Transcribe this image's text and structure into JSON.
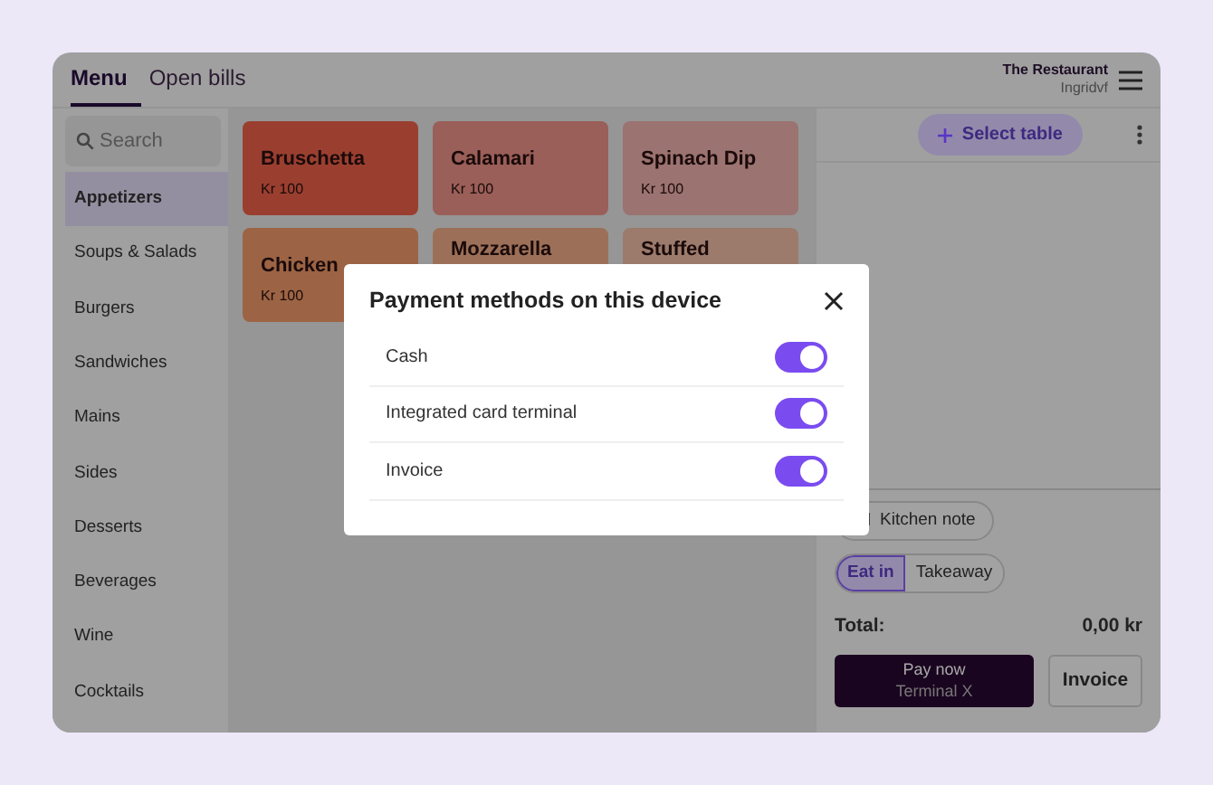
{
  "tabs": [
    {
      "label": "Menu",
      "selected": true
    },
    {
      "label": "Open bills",
      "selected": false
    }
  ],
  "account": {
    "restaurant": "The Restaurant",
    "user": "Ingridvf"
  },
  "search": {
    "placeholder": "Search"
  },
  "categories": [
    {
      "label": "Appetizers",
      "selected": true
    },
    {
      "label": "Soups & Salads",
      "selected": false
    },
    {
      "label": "Burgers",
      "selected": false
    },
    {
      "label": "Sandwiches",
      "selected": false
    },
    {
      "label": "Mains",
      "selected": false
    },
    {
      "label": "Sides",
      "selected": false
    },
    {
      "label": "Desserts",
      "selected": false
    },
    {
      "label": "Beverages",
      "selected": false
    },
    {
      "label": "Wine",
      "selected": false
    },
    {
      "label": "Cocktails",
      "selected": false
    }
  ],
  "products": [
    {
      "name": "Bruschetta",
      "price": "Kr 100",
      "color": "#9a3f30"
    },
    {
      "name": "Calamari",
      "price": "Kr 100",
      "color": "#9a5f58"
    },
    {
      "name": "Spinach Dip",
      "price": "Kr 100",
      "color": "#9b7370"
    },
    {
      "name": "Chicken",
      "price": "Kr 100",
      "color": "#9c6444"
    },
    {
      "name": "Mozzarella",
      "color": "#9c7058"
    },
    {
      "name": "Stuffed",
      "color": "#9c7b6c"
    }
  ],
  "order": {
    "select_table": "Select table",
    "kitchen_note": "Kitchen note",
    "modes": [
      {
        "label": "Eat in",
        "selected": true
      },
      {
        "label": "Takeaway",
        "selected": false
      }
    ],
    "total_label": "Total:",
    "total": "0,00 kr",
    "pay_now": "Pay now",
    "pay_terminal": "Terminal X",
    "invoice": "Invoice"
  },
  "dialog": {
    "title": "Payment methods on this device",
    "methods": [
      {
        "label": "Cash",
        "on": true
      },
      {
        "label": "Integrated card terminal",
        "on": true
      },
      {
        "label": "Invoice",
        "on": true
      }
    ]
  }
}
